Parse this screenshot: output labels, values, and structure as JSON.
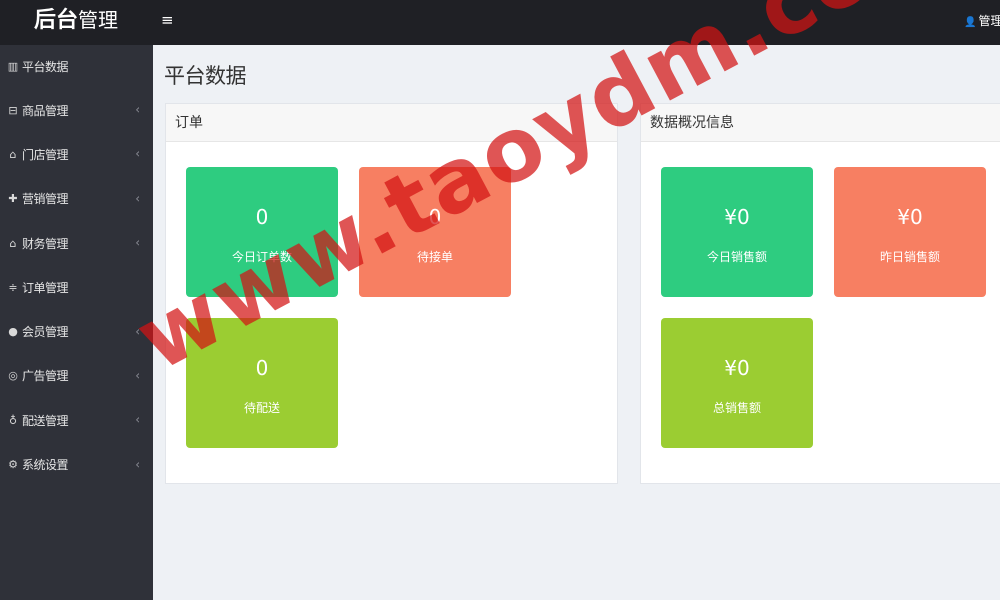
{
  "brand": {
    "bold": "后台",
    "light": "管理"
  },
  "header": {
    "menu_icon": "≡",
    "user_icon": "user-icon",
    "user_label": "管理员"
  },
  "sidebar": {
    "items": [
      {
        "icon": "bar-chart-icon",
        "glyph": "📊",
        "label": "平台数据",
        "has_children": false
      },
      {
        "icon": "folder-icon",
        "glyph": "⊟",
        "label": "商品管理",
        "has_children": true
      },
      {
        "icon": "bank-icon",
        "glyph": "🏛",
        "label": "门店管理",
        "has_children": true
      },
      {
        "icon": "gift-icon",
        "glyph": "🎁",
        "label": "营销管理",
        "has_children": true
      },
      {
        "icon": "bank-icon",
        "glyph": "🏛",
        "label": "财务管理",
        "has_children": true
      },
      {
        "icon": "sliders-icon",
        "glyph": "☰",
        "label": "订单管理",
        "has_children": false
      },
      {
        "icon": "user-icon",
        "glyph": "👤",
        "label": "会员管理",
        "has_children": true
      },
      {
        "icon": "life-ring-icon",
        "glyph": "◎",
        "label": "广告管理",
        "has_children": true
      },
      {
        "icon": "map-marker-icon",
        "glyph": "📍",
        "label": "配送管理",
        "has_children": true
      },
      {
        "icon": "cogs-icon",
        "glyph": "⚙",
        "label": "系统设置",
        "has_children": true
      }
    ],
    "chevron": "‹"
  },
  "main": {
    "title": "平台数据",
    "orders_panel": {
      "title": "订单",
      "tiles": [
        {
          "value": "0",
          "label": "今日订单数",
          "color": "#2ecc80"
        },
        {
          "value": "0",
          "label": "待接单",
          "color": "#f77f62"
        },
        {
          "value": "0",
          "label": "待配送",
          "color": "#9bcd32"
        }
      ]
    },
    "stats_panel": {
      "title": "数据概况信息",
      "tiles": [
        {
          "value": "¥0",
          "label": "今日销售额",
          "color": "#2ecc80"
        },
        {
          "value": "¥0",
          "label": "昨日销售额",
          "color": "#f77f62"
        },
        {
          "value": "¥0",
          "label": "总销售额",
          "color": "#9bcd32"
        }
      ]
    }
  },
  "watermark": "www.taoydm.com"
}
